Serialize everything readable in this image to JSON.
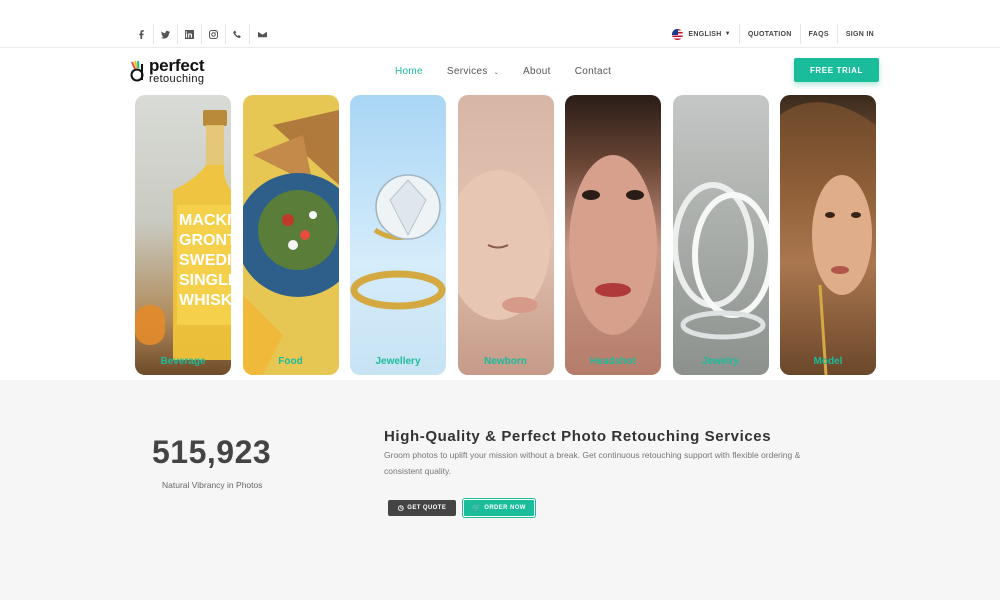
{
  "colors": {
    "accent": "#1abc9c",
    "dark_button": "#444444",
    "section_bg": "#f6f6f6"
  },
  "topbar": {
    "social_icons": [
      "facebook-icon",
      "twitter-icon",
      "linkedin-icon",
      "instagram-icon",
      "phone-icon",
      "mail-icon"
    ],
    "language": "ENGLISH",
    "quotation": "QUOTATION",
    "faqs": "FAQS",
    "sign_in": "SIGN IN"
  },
  "logo": {
    "line1": "perfect",
    "line2": "retouching"
  },
  "nav": {
    "home": "Home",
    "services": "Services",
    "about": "About",
    "contact": "Contact"
  },
  "free_trial": "FREE TRIAL",
  "cards": [
    {
      "label": "Beverage"
    },
    {
      "label": "Food"
    },
    {
      "label": "Jewellery"
    },
    {
      "label": "Newborn"
    },
    {
      "label": "Headshot"
    },
    {
      "label": "Jewelry"
    },
    {
      "label": "Model"
    }
  ],
  "stats": {
    "number": "515,923",
    "caption": "Natural Vibrancy in Photos"
  },
  "hero": {
    "headline": "High-Quality & Perfect Photo Retouching Services",
    "description": "Groom photos to uplift your mission without a break. Get continuous retouching support with flexible ordering & consistent quality.",
    "get_quote": "GET QUOTE",
    "order_now": "ORDER NOW"
  }
}
